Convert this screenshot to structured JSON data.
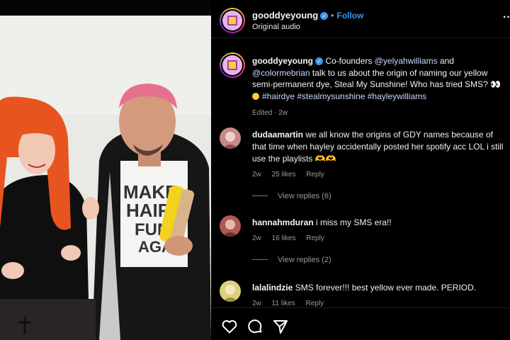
{
  "post": {
    "username": "gooddyeyoung",
    "follow_label": "Follow",
    "dot": "•",
    "audio_label": "Original audio",
    "more_icon": "more-options-icon"
  },
  "caption": {
    "username": "gooddyeyoung",
    "text_1": "Co-founders",
    "mention_1": "@yelyahwilliams",
    "text_2": "and",
    "mention_2": "@colormebrian",
    "text_3": "talk to us about the origin of naming our yellow semi-permanent dye, Steal My Sunshine! Who has tried SMS?",
    "emoji_tail": "👀",
    "hashtags": "#hairdye #stealmysunshine #hayleywilliams",
    "meta": "Edited · 2w"
  },
  "comments": [
    {
      "username": "dudaamartin",
      "text": "we all know the origins of GDY names because of that time when hayley accidentally posted her spotify acc LOL i still use the playlists 🫶🫶",
      "time": "2w",
      "likes": "25 likes",
      "reply": "Reply",
      "view_replies": "View replies (6)"
    },
    {
      "username": "hannahmduran",
      "text": "i miss my SMS era!!",
      "time": "2w",
      "likes": "16 likes",
      "reply": "Reply",
      "view_replies": "View replies (2)"
    },
    {
      "username": "lalalindzie",
      "text": "SMS forever!!! best yellow ever made. PERIOD.",
      "time": "2w",
      "likes": "11 likes",
      "reply": "Reply"
    }
  ],
  "media": {
    "shirt_text_lines": [
      "MAKE",
      "HAIR",
      "FUN",
      "AGA"
    ]
  },
  "actions": [
    "heart-icon",
    "comment-icon",
    "share-icon"
  ],
  "colors": {
    "background": "#000000",
    "link": "#3897f0",
    "verified": "#3897f0",
    "hair_orange": "#e8541f",
    "hair_pink": "#e8708f",
    "product_yellow": "#f2d21c"
  }
}
